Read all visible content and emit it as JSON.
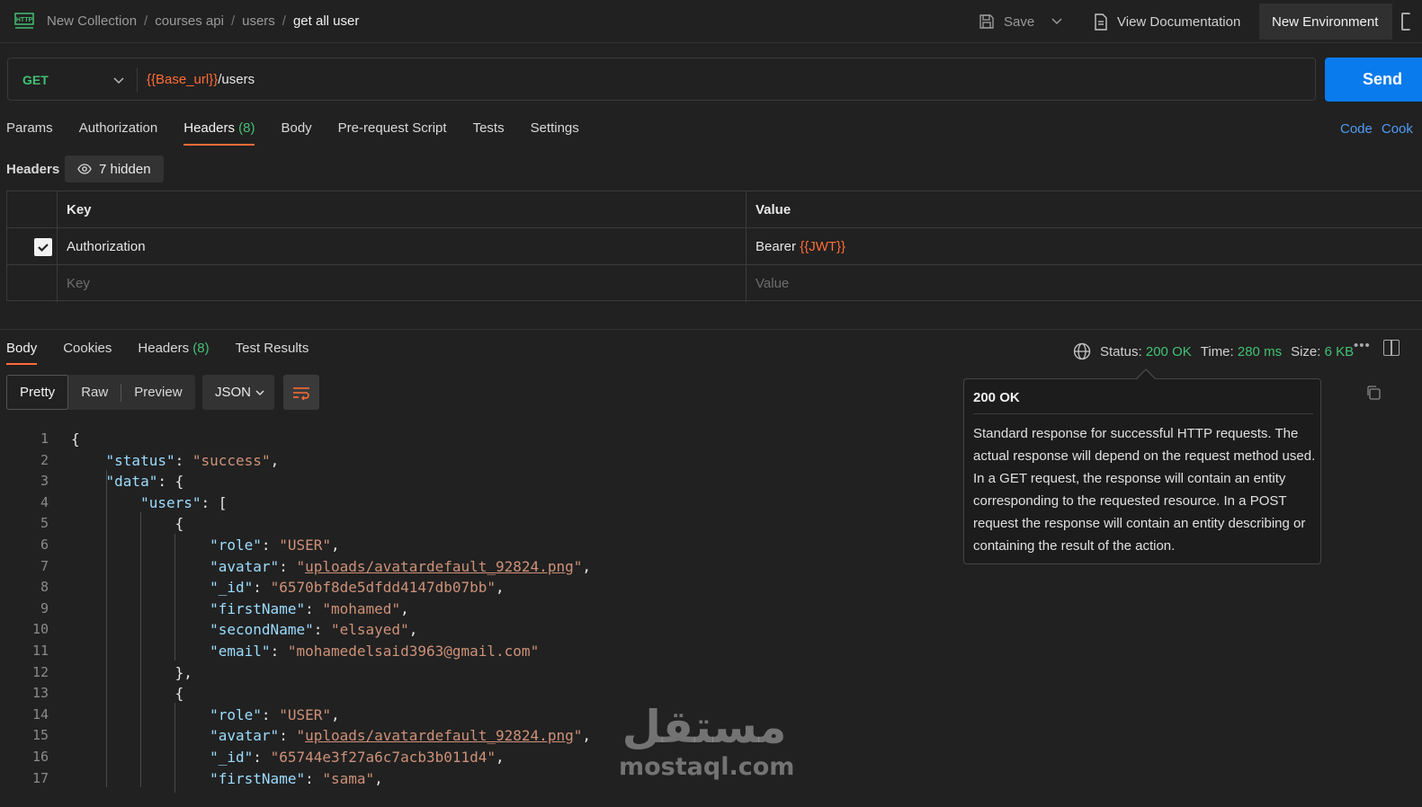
{
  "breadcrumb": {
    "items": [
      "New Collection",
      "courses api",
      "users"
    ],
    "current": "get all user"
  },
  "toolbar": {
    "save_label": "Save",
    "view_docs_label": "View Documentation",
    "environment": "New Environment"
  },
  "request": {
    "method": "GET",
    "url_variable": "{{Base_url}}",
    "url_path": "/users",
    "send_label": "Send"
  },
  "request_tabs": [
    {
      "label": "Params"
    },
    {
      "label": "Authorization"
    },
    {
      "label": "Headers",
      "count": "(8)"
    },
    {
      "label": "Body"
    },
    {
      "label": "Pre-request Script"
    },
    {
      "label": "Tests"
    },
    {
      "label": "Settings"
    }
  ],
  "side_links": {
    "code": "Code",
    "cookies": "Cook"
  },
  "headers": {
    "label": "Headers",
    "hidden_label": "7 hidden",
    "columns": {
      "key": "Key",
      "value": "Value"
    },
    "rows": [
      {
        "checked": true,
        "key": "Authorization",
        "value_prefix": "Bearer ",
        "value_variable": "{{JWT}}"
      }
    ],
    "placeholder": {
      "key": "Key",
      "value": "Value"
    }
  },
  "response_tabs": [
    {
      "label": "Body"
    },
    {
      "label": "Cookies"
    },
    {
      "label": "Headers",
      "count": "(8)"
    },
    {
      "label": "Test Results"
    }
  ],
  "response_status": {
    "status_label": "Status:",
    "status": "200 OK",
    "time_label": "Time:",
    "time": "280 ms",
    "size_label": "Size:",
    "size": "6 KB",
    "more": "•••"
  },
  "view_modes": {
    "pretty": "Pretty",
    "raw": "Raw",
    "preview": "Preview",
    "format": "JSON"
  },
  "tooltip": {
    "title": "200 OK",
    "body": "Standard response for successful HTTP requests. The actual response will depend on the request method used. In a GET request, the response will contain an entity corresponding to the requested resource. In a POST request the response will contain an entity describing or containing the result of the action."
  },
  "response_body": {
    "status": "success",
    "users": [
      {
        "role": "USER",
        "avatar": "uploads/avatardefault_92824.png",
        "_id": "6570bf8de5dfdd4147db07bb",
        "firstName": "mohamed",
        "secondName": "elsayed",
        "email": "mohamedelsaid3963@gmail.com"
      },
      {
        "role": "USER",
        "avatar": "uploads/avatardefault_92824.png",
        "_id": "65744e3f27a6c7acb3b011d4",
        "firstName": "sama"
      }
    ]
  },
  "line_numbers": [
    "1",
    "2",
    "3",
    "4",
    "5",
    "6",
    "7",
    "8",
    "9",
    "10",
    "11",
    "12",
    "13",
    "14",
    "15",
    "16",
    "17"
  ],
  "watermark": {
    "arabic": "مستقل",
    "latin": "mostaql.com"
  },
  "colors": {
    "accent": "#ff6c37",
    "send": "#097bed",
    "success": "#43c073",
    "link": "#4f9cf4"
  }
}
